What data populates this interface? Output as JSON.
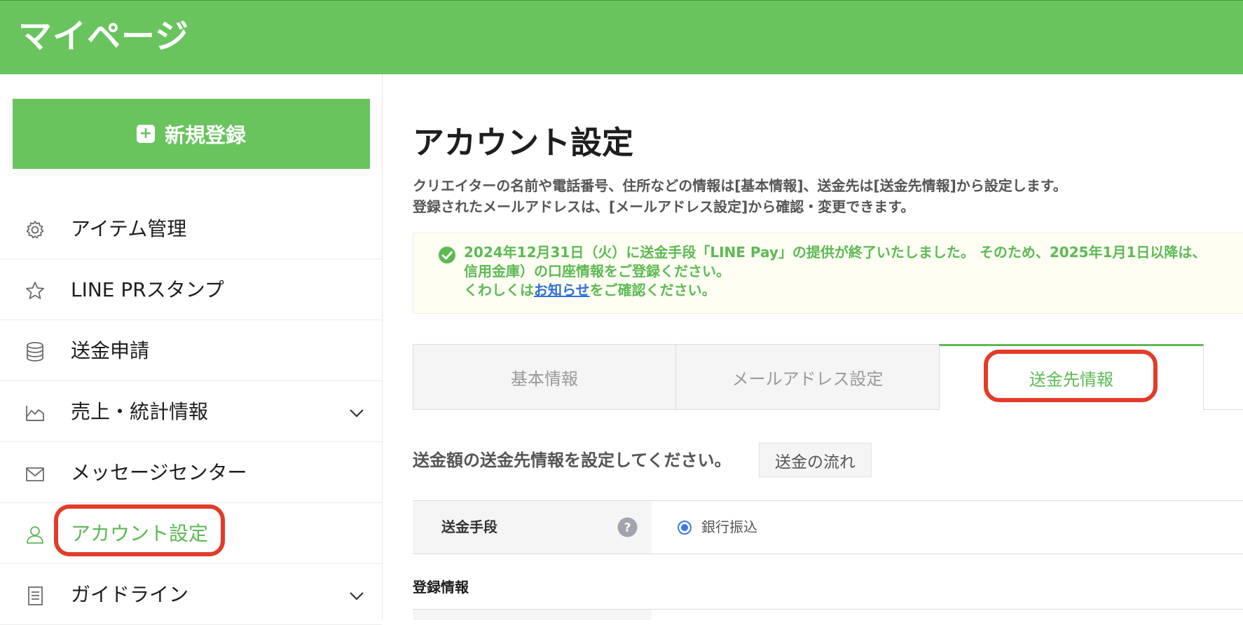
{
  "header": {
    "title": "マイページ"
  },
  "sidebar": {
    "new_button": {
      "icon": "plus-square-icon",
      "label": "新規登録"
    },
    "items": [
      {
        "label": "アイテム管理",
        "icon": "gear-icon",
        "active": false,
        "expandable": false
      },
      {
        "label": "LINE PRスタンプ",
        "icon": "star-icon",
        "active": false,
        "expandable": false
      },
      {
        "label": "送金申請",
        "icon": "coin-stack-icon",
        "active": false,
        "expandable": false
      },
      {
        "label": "売上・統計情報",
        "icon": "chart-icon",
        "active": false,
        "expandable": true
      },
      {
        "label": "メッセージセンター",
        "icon": "envelope-icon",
        "active": false,
        "expandable": false
      },
      {
        "label": "アカウント設定",
        "icon": "user-icon",
        "active": true,
        "expandable": false
      },
      {
        "label": "ガイドライン",
        "icon": "document-icon",
        "active": false,
        "expandable": true
      }
    ]
  },
  "main": {
    "title": "アカウント設定",
    "description": [
      "クリエイターの名前や電話番号、住所などの情報は[基本情報]、送金先は[送金先情報]から設定します。",
      "登録されたメールアドレスは、[メールアドレス設定]から確認・変更できます。"
    ],
    "notice": {
      "icon": "check-circle-icon",
      "line1": "2024年12月31日（火）に送金手段「LINE Pay」の提供が終了いたしました。 そのため、2025年1月1日以降は、",
      "line2": "信用金庫）の口座情報をご登録ください。",
      "line3_prefix": "くわしくは",
      "line3_link": "お知らせ",
      "line3_suffix": "をご確認ください。"
    },
    "tabs": [
      {
        "label": "基本情報",
        "active": false
      },
      {
        "label": "メールアドレス設定",
        "active": false
      },
      {
        "label": "送金先情報",
        "active": true
      }
    ],
    "section_heading": "送金額の送金先情報を設定してください。",
    "flow_button": "送金の流れ",
    "method_row": {
      "label": "送金手段",
      "help_icon": "question-circle-icon",
      "option": "銀行振込",
      "selected": true
    },
    "registration_heading": "登録情報"
  },
  "colors": {
    "brand_green": "#69c45e",
    "active_green": "#5cba53",
    "highlight_red": "#e33b2a",
    "link_blue": "#2f6fd8",
    "radio_blue": "#3b7be0"
  }
}
